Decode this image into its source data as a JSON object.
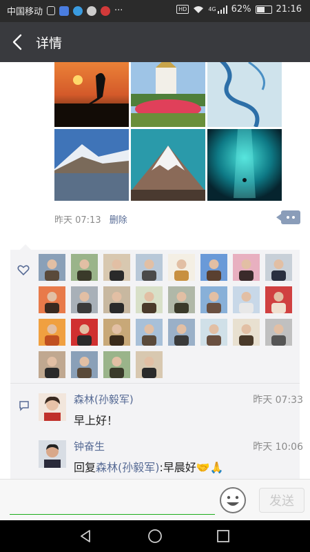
{
  "status_bar": {
    "carrier": "中国移动",
    "more": "···",
    "hd": "HD",
    "network": "4G",
    "battery": "62%",
    "battery_level": 0.62,
    "time": "21:16"
  },
  "header": {
    "title": "详情"
  },
  "post": {
    "photos": [
      "crane-sunset",
      "castle-garden",
      "river-aerial",
      "snow-mountain-lake",
      "volcano-peak",
      "underwater-cave"
    ],
    "time": "昨天 07:13",
    "delete_label": "删除"
  },
  "likes": {
    "count": 28
  },
  "comments": [
    {
      "name": "森林(孙毅军)",
      "time": "昨天 07:33",
      "text": "早上好！"
    },
    {
      "name": "钟奋生",
      "time": "昨天 10:06",
      "reply_prefix": "回复",
      "reply_to": "森林(孙毅军)",
      "text": ":早晨好🤝🙏"
    }
  ],
  "input": {
    "placeholder": "",
    "send_label": "发送"
  },
  "colors": {
    "title_bar": "#393a3e",
    "link": "#576b95",
    "accent": "#1aad19"
  }
}
